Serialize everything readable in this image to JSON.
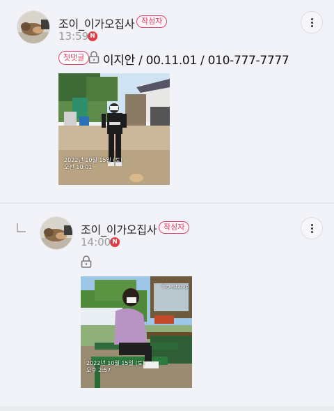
{
  "comments": [
    {
      "nickname": "조이_이가오집사",
      "author_badge": "작성자",
      "time": "13:59",
      "new_badge": "N",
      "first_comment_badge": "첫댓글",
      "text": "이지안 / 00.11.01 / 010-777-7777",
      "photo": {
        "timestamp_date": "2022년 10월 15일 (토)",
        "timestamp_time": "오전 10:01"
      }
    },
    {
      "nickname": "조이_이가오집사",
      "author_badge": "작성자",
      "time": "14:00",
      "new_badge": "N",
      "photo": {
        "timestamp_date": "2022년 10월 15일 (토)",
        "timestamp_time": "오후 2:57",
        "watermark": "Timestamp"
      }
    }
  ],
  "icons": {
    "more": "more-vertical-icon",
    "lock": "lock-icon",
    "reply": "reply-arrow-icon"
  },
  "colors": {
    "accent": "#e0406a",
    "new": "#e03a45",
    "background": "#f2f3f8"
  }
}
